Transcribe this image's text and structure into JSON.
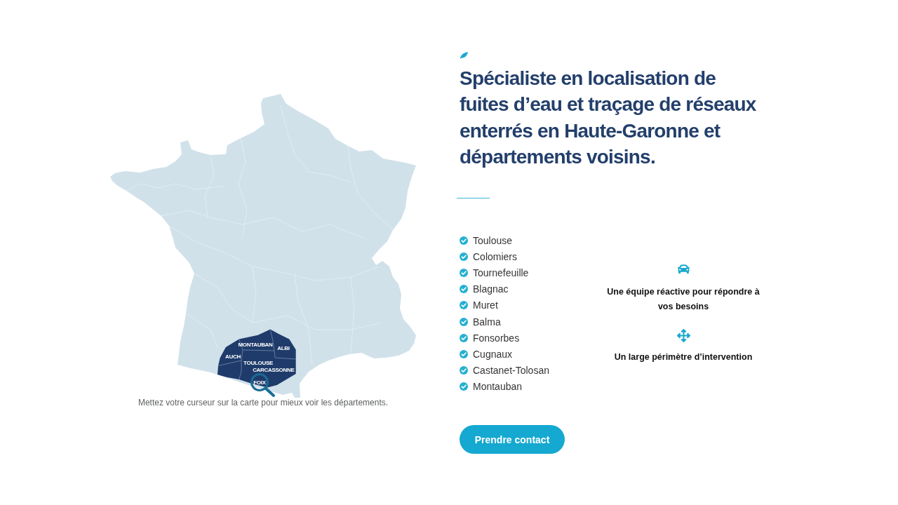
{
  "map": {
    "department_labels": [
      "MONTAUBAN",
      "ALBI",
      "AUCH",
      "TOULOUSE",
      "CARCASSONNE",
      "FOIX"
    ],
    "caption": "Mettez votre curseur sur la carte pour mieux voir les départements."
  },
  "intro": {
    "heading": "Spécialiste en localisation de fuites d’eau et traçage de réseaux enterrés en Haute-Garonne et départements voisins."
  },
  "cities": [
    "Toulouse",
    "Colomiers",
    "Tournefeuille",
    "Blagnac",
    "Muret",
    "Balma",
    "Fonsorbes",
    "Cugnaux",
    "Castanet-Tolosan",
    "Montauban"
  ],
  "features": [
    {
      "text": "Une équipe réactive pour répondre à vos besoins"
    },
    {
      "text": "Un large périmètre d’intervention"
    }
  ],
  "cta_button": "Prendre contact"
}
